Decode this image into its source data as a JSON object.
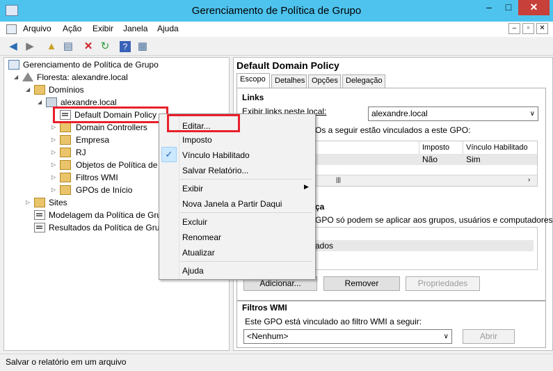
{
  "window": {
    "title": "Gerenciamento de Política de Grupo",
    "minimize": "–",
    "maximize": "□",
    "close": "✕"
  },
  "menu": [
    "Arquivo",
    "Ação",
    "Exibir",
    "Janela",
    "Ajuda"
  ],
  "tree": {
    "root": "Gerenciamento de Política de Grupo",
    "forest": "Floresta: alexandre.local",
    "domains": "Domínios",
    "domain": "alexandre.local",
    "items": [
      "Default Domain Policy",
      "Domain Controllers",
      "Empresa",
      "RJ",
      "Objetos de Política de",
      "Filtros WMI",
      "GPOs de Início"
    ],
    "sites": "Sites",
    "modeling": "Modelagem da Política de Gru",
    "results": "Resultados da Política de Grup"
  },
  "gpo": {
    "title": "Default Domain Policy",
    "tabs": [
      "Escopo",
      "Detalhes",
      "Opções",
      "Delegação"
    ],
    "links_title": "Links",
    "links_label": "Exibir links neste local:",
    "links_value": "alexandre.local",
    "links_desc": "Os a seguir estão vinculados a este GPO:",
    "links_columns": [
      "Imposto",
      "Vínculo Habilitado"
    ],
    "links_row": [
      "Não",
      "Sim"
    ],
    "filter_title_tail": "ça",
    "filter_desc": "GPO só podem se aplicar aos grupos, usuários e computadores a s",
    "filter_item_tail": "ados",
    "buttons": [
      "Adicionar...",
      "Remover",
      "Propriedades"
    ],
    "wmi_title": "Filtros WMI",
    "wmi_desc": "Este GPO está vinculado ao filtro WMI a seguir:",
    "wmi_value": "<Nenhum>",
    "wmi_open": "Abrir"
  },
  "context_menu": {
    "items": [
      "Editar...",
      "Imposto",
      "Vínculo Habilitado",
      "Salvar Relatório...",
      "Exibir",
      "Nova Janela a Partir Daqui",
      "Excluir",
      "Renomear",
      "Atualizar",
      "Ajuda"
    ],
    "checked": "Vínculo Habilitado"
  },
  "status": "Salvar o relatório em um arquivo",
  "colors": {
    "titlebar": "#4ec3ee",
    "highlight": "#e8202a"
  }
}
